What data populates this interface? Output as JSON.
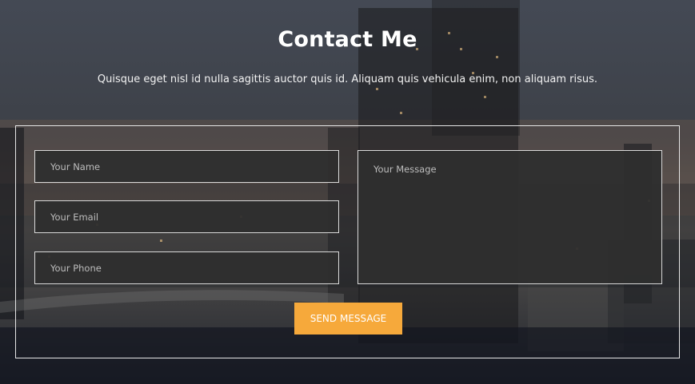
{
  "header": {
    "title": "Contact Me",
    "subtitle": "Quisque eget nisl id nulla sagittis auctor quis id. Aliquam quis vehicula enim, non aliquam risus."
  },
  "form": {
    "name_placeholder": "Your Name",
    "email_placeholder": "Your Email",
    "phone_placeholder": "Your Phone",
    "message_placeholder": "Your Message",
    "submit_label": "SEND MESSAGE"
  },
  "colors": {
    "accent": "#f6a93b",
    "field_bg": "#2e2e2e",
    "border": "#e6e6e6"
  },
  "icons": {
    "background": "city-skyline-photo"
  }
}
